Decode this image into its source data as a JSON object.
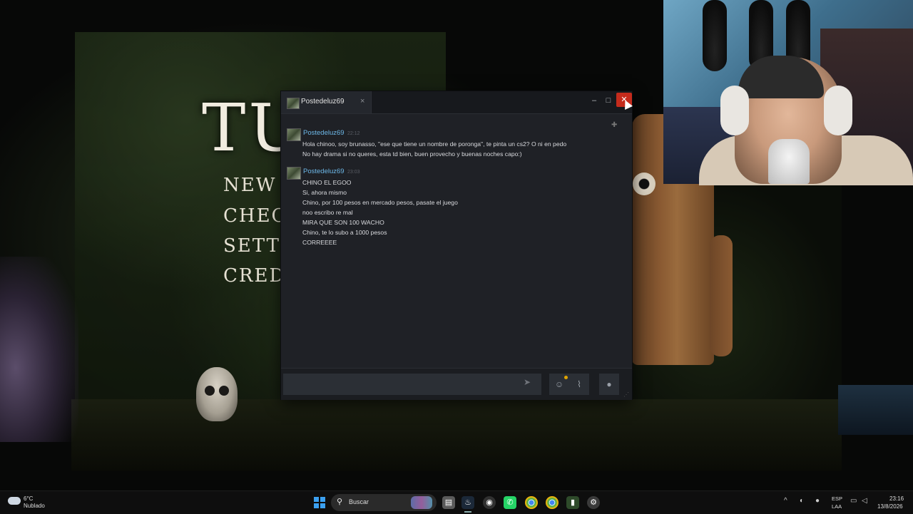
{
  "game": {
    "title": "TU",
    "menu": [
      "NEW G",
      "CHECI",
      "SETTIN",
      "CREDI"
    ]
  },
  "chat": {
    "tab_title": "Postedeluz69",
    "tab_close": "×",
    "window_controls": {
      "minimize": "–",
      "maximize": "□",
      "close": "✕"
    },
    "messages": [
      {
        "author": "Postedeluz69",
        "time": "22:12",
        "lines": [
          "Hola chinoo, soy brunasso, \"ese que tiene un nombre de poronga\", te pinta un cs2? O ni en pedo",
          "No hay drama si no queres, esta td bien, buen provecho y buenas noches capo:)"
        ]
      },
      {
        "author": "Postedeluz69",
        "time": "23:03",
        "lines": [
          "CHINO EL EGOO",
          "Si, ahora mismo",
          "Chino, por 100 pesos en mercado pesos, pasate el juego",
          "noo escribo re mal",
          "MIRA QUE SON 100 WACHO",
          "Chino, te lo subo a 1000 pesos",
          "CORREEEE"
        ]
      }
    ],
    "input_value": "",
    "icons": {
      "send": "send-icon",
      "emoji": "emoji-icon",
      "attach": "paperclip-icon",
      "voice": "microphone-icon",
      "pin": "pin-icon"
    }
  },
  "taskbar": {
    "weather_temp": "6°C",
    "weather_desc": "Nublado",
    "search_label": "Buscar",
    "lang_top": "ESP",
    "lang_bottom": "LAA",
    "time": "23:16",
    "date": "13/8/2026",
    "apps": [
      "file-explorer-icon",
      "steam-icon",
      "obs-icon",
      "whatsapp-icon",
      "chrome-icon",
      "chrome-icon",
      "game-icon",
      "settings-icon"
    ]
  },
  "colors": {
    "accent_name": "#6db8e8",
    "close_red": "#c42b1c",
    "chat_bg": "#1f2126"
  }
}
